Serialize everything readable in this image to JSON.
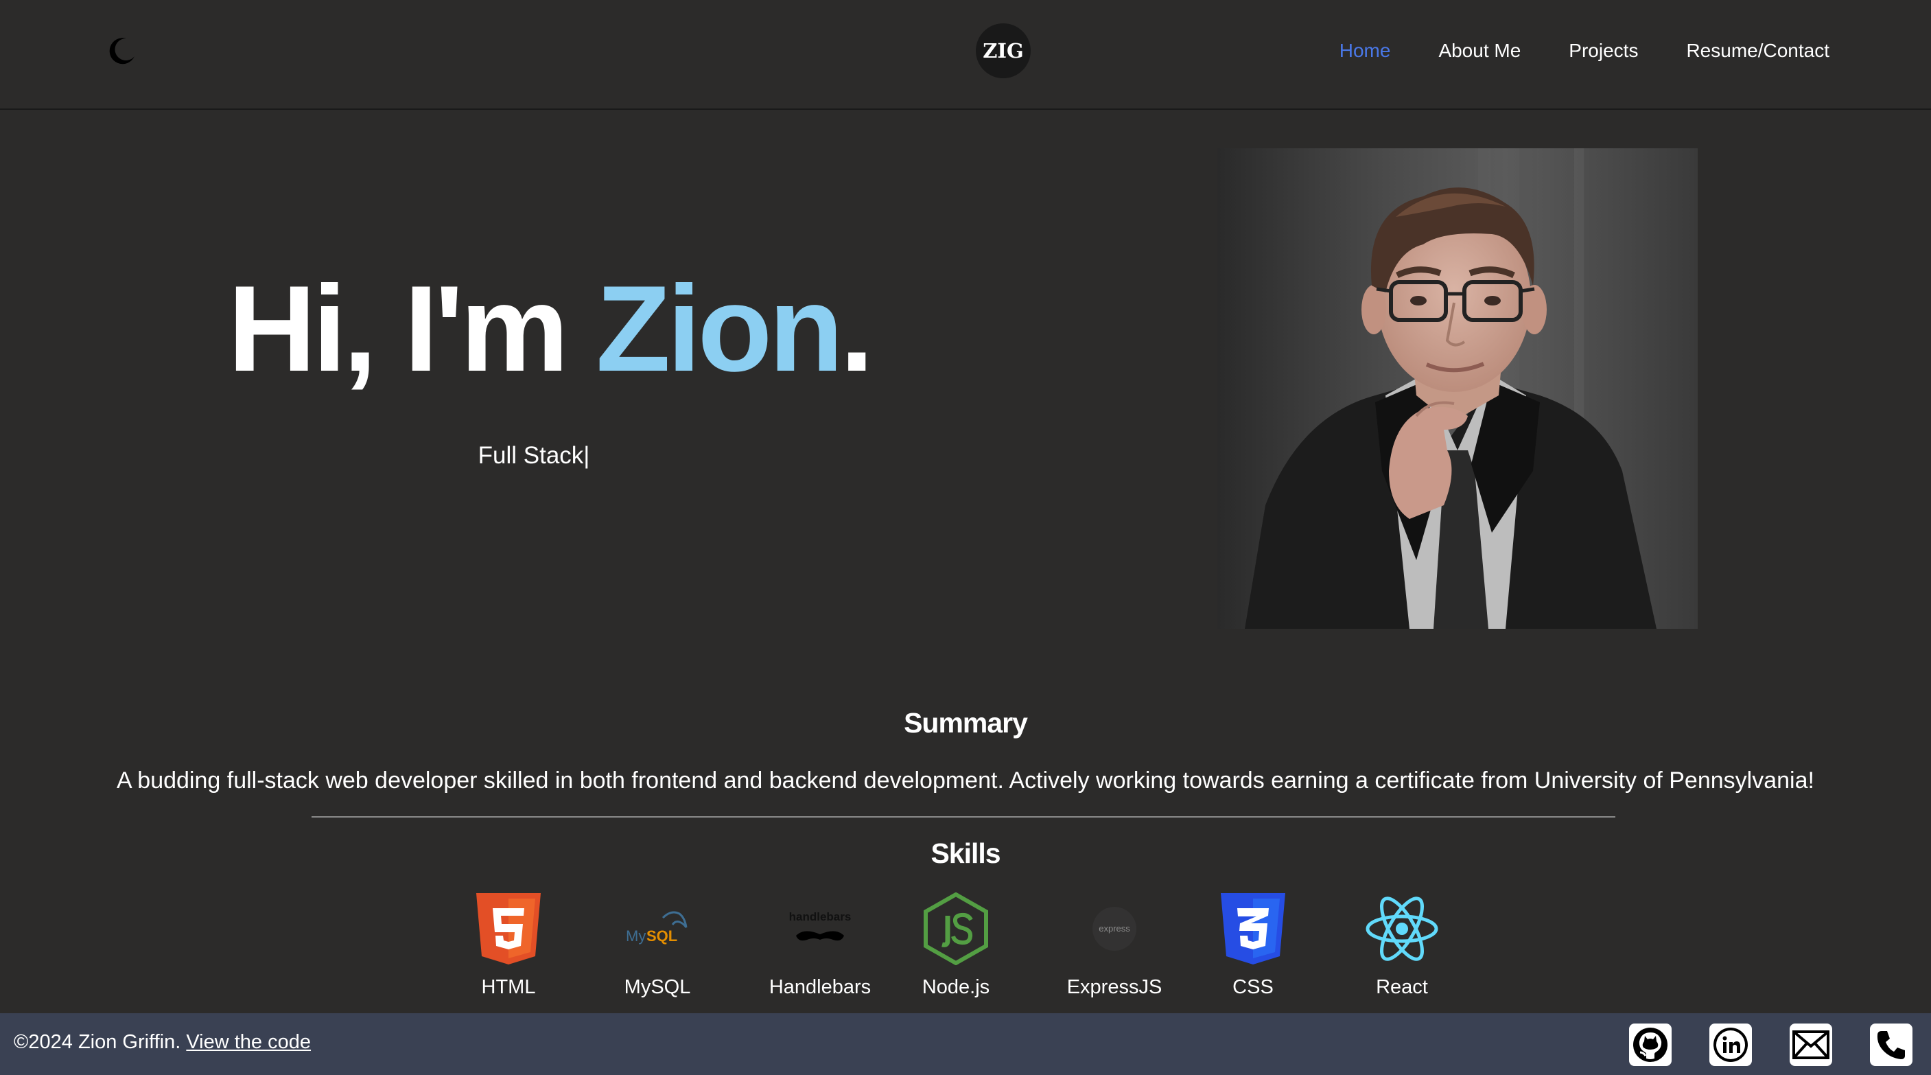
{
  "header": {
    "theme_toggle_icon": "moon-icon",
    "logo_text": "ZIG",
    "nav": [
      {
        "label": "Home",
        "active": true
      },
      {
        "label": "About Me",
        "active": false
      },
      {
        "label": "Projects",
        "active": false
      },
      {
        "label": "Resume/Contact",
        "active": false
      }
    ],
    "active_color": "#4a78e8"
  },
  "hero": {
    "greeting": "Hi, I'm ",
    "name": "Zion",
    "punctuation": ".",
    "name_color": "#8ccff2",
    "typed_text": "Full Stack",
    "typed_cursor": "|"
  },
  "summary": {
    "title": "Summary",
    "text": "A budding full-stack web developer skilled in both frontend and backend development. Actively working towards earning a certificate from University of Pennsylvania!"
  },
  "skills": {
    "title": "Skills",
    "items": [
      {
        "label": "HTML",
        "icon": "html5-icon"
      },
      {
        "label": "MySQL",
        "icon": "mysql-icon"
      },
      {
        "label": "Handlebars",
        "icon": "handlebars-icon"
      },
      {
        "label": "Node.js",
        "icon": "nodejs-icon"
      },
      {
        "label": "ExpressJS",
        "icon": "express-icon"
      },
      {
        "label": "CSS",
        "icon": "css3-icon"
      },
      {
        "label": "React",
        "icon": "react-icon"
      }
    ]
  },
  "footer": {
    "copyright": "©2024 Zion Griffin.",
    "code_link": "View the code",
    "social_icons": [
      "github-icon",
      "linkedin-icon",
      "email-icon",
      "phone-icon"
    ],
    "background": "#3a4153"
  }
}
